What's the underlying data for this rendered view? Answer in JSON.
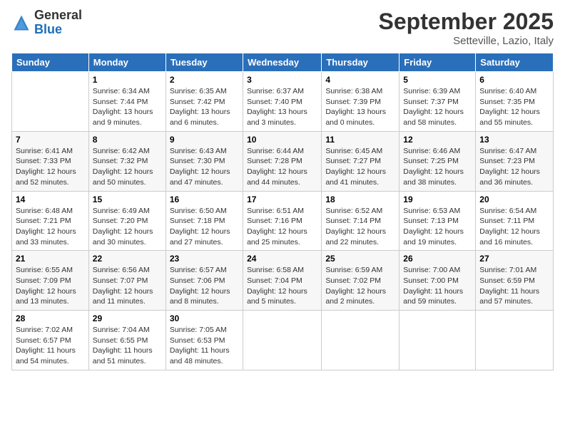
{
  "header": {
    "logo_general": "General",
    "logo_blue": "Blue",
    "month": "September 2025",
    "location": "Setteville, Lazio, Italy"
  },
  "days_of_week": [
    "Sunday",
    "Monday",
    "Tuesday",
    "Wednesday",
    "Thursday",
    "Friday",
    "Saturday"
  ],
  "weeks": [
    [
      {
        "num": "",
        "sunrise": "",
        "sunset": "",
        "daylight": ""
      },
      {
        "num": "1",
        "sunrise": "Sunrise: 6:34 AM",
        "sunset": "Sunset: 7:44 PM",
        "daylight": "Daylight: 13 hours and 9 minutes."
      },
      {
        "num": "2",
        "sunrise": "Sunrise: 6:35 AM",
        "sunset": "Sunset: 7:42 PM",
        "daylight": "Daylight: 13 hours and 6 minutes."
      },
      {
        "num": "3",
        "sunrise": "Sunrise: 6:37 AM",
        "sunset": "Sunset: 7:40 PM",
        "daylight": "Daylight: 13 hours and 3 minutes."
      },
      {
        "num": "4",
        "sunrise": "Sunrise: 6:38 AM",
        "sunset": "Sunset: 7:39 PM",
        "daylight": "Daylight: 13 hours and 0 minutes."
      },
      {
        "num": "5",
        "sunrise": "Sunrise: 6:39 AM",
        "sunset": "Sunset: 7:37 PM",
        "daylight": "Daylight: 12 hours and 58 minutes."
      },
      {
        "num": "6",
        "sunrise": "Sunrise: 6:40 AM",
        "sunset": "Sunset: 7:35 PM",
        "daylight": "Daylight: 12 hours and 55 minutes."
      }
    ],
    [
      {
        "num": "7",
        "sunrise": "Sunrise: 6:41 AM",
        "sunset": "Sunset: 7:33 PM",
        "daylight": "Daylight: 12 hours and 52 minutes."
      },
      {
        "num": "8",
        "sunrise": "Sunrise: 6:42 AM",
        "sunset": "Sunset: 7:32 PM",
        "daylight": "Daylight: 12 hours and 50 minutes."
      },
      {
        "num": "9",
        "sunrise": "Sunrise: 6:43 AM",
        "sunset": "Sunset: 7:30 PM",
        "daylight": "Daylight: 12 hours and 47 minutes."
      },
      {
        "num": "10",
        "sunrise": "Sunrise: 6:44 AM",
        "sunset": "Sunset: 7:28 PM",
        "daylight": "Daylight: 12 hours and 44 minutes."
      },
      {
        "num": "11",
        "sunrise": "Sunrise: 6:45 AM",
        "sunset": "Sunset: 7:27 PM",
        "daylight": "Daylight: 12 hours and 41 minutes."
      },
      {
        "num": "12",
        "sunrise": "Sunrise: 6:46 AM",
        "sunset": "Sunset: 7:25 PM",
        "daylight": "Daylight: 12 hours and 38 minutes."
      },
      {
        "num": "13",
        "sunrise": "Sunrise: 6:47 AM",
        "sunset": "Sunset: 7:23 PM",
        "daylight": "Daylight: 12 hours and 36 minutes."
      }
    ],
    [
      {
        "num": "14",
        "sunrise": "Sunrise: 6:48 AM",
        "sunset": "Sunset: 7:21 PM",
        "daylight": "Daylight: 12 hours and 33 minutes."
      },
      {
        "num": "15",
        "sunrise": "Sunrise: 6:49 AM",
        "sunset": "Sunset: 7:20 PM",
        "daylight": "Daylight: 12 hours and 30 minutes."
      },
      {
        "num": "16",
        "sunrise": "Sunrise: 6:50 AM",
        "sunset": "Sunset: 7:18 PM",
        "daylight": "Daylight: 12 hours and 27 minutes."
      },
      {
        "num": "17",
        "sunrise": "Sunrise: 6:51 AM",
        "sunset": "Sunset: 7:16 PM",
        "daylight": "Daylight: 12 hours and 25 minutes."
      },
      {
        "num": "18",
        "sunrise": "Sunrise: 6:52 AM",
        "sunset": "Sunset: 7:14 PM",
        "daylight": "Daylight: 12 hours and 22 minutes."
      },
      {
        "num": "19",
        "sunrise": "Sunrise: 6:53 AM",
        "sunset": "Sunset: 7:13 PM",
        "daylight": "Daylight: 12 hours and 19 minutes."
      },
      {
        "num": "20",
        "sunrise": "Sunrise: 6:54 AM",
        "sunset": "Sunset: 7:11 PM",
        "daylight": "Daylight: 12 hours and 16 minutes."
      }
    ],
    [
      {
        "num": "21",
        "sunrise": "Sunrise: 6:55 AM",
        "sunset": "Sunset: 7:09 PM",
        "daylight": "Daylight: 12 hours and 13 minutes."
      },
      {
        "num": "22",
        "sunrise": "Sunrise: 6:56 AM",
        "sunset": "Sunset: 7:07 PM",
        "daylight": "Daylight: 12 hours and 11 minutes."
      },
      {
        "num": "23",
        "sunrise": "Sunrise: 6:57 AM",
        "sunset": "Sunset: 7:06 PM",
        "daylight": "Daylight: 12 hours and 8 minutes."
      },
      {
        "num": "24",
        "sunrise": "Sunrise: 6:58 AM",
        "sunset": "Sunset: 7:04 PM",
        "daylight": "Daylight: 12 hours and 5 minutes."
      },
      {
        "num": "25",
        "sunrise": "Sunrise: 6:59 AM",
        "sunset": "Sunset: 7:02 PM",
        "daylight": "Daylight: 12 hours and 2 minutes."
      },
      {
        "num": "26",
        "sunrise": "Sunrise: 7:00 AM",
        "sunset": "Sunset: 7:00 PM",
        "daylight": "Daylight: 11 hours and 59 minutes."
      },
      {
        "num": "27",
        "sunrise": "Sunrise: 7:01 AM",
        "sunset": "Sunset: 6:59 PM",
        "daylight": "Daylight: 11 hours and 57 minutes."
      }
    ],
    [
      {
        "num": "28",
        "sunrise": "Sunrise: 7:02 AM",
        "sunset": "Sunset: 6:57 PM",
        "daylight": "Daylight: 11 hours and 54 minutes."
      },
      {
        "num": "29",
        "sunrise": "Sunrise: 7:04 AM",
        "sunset": "Sunset: 6:55 PM",
        "daylight": "Daylight: 11 hours and 51 minutes."
      },
      {
        "num": "30",
        "sunrise": "Sunrise: 7:05 AM",
        "sunset": "Sunset: 6:53 PM",
        "daylight": "Daylight: 11 hours and 48 minutes."
      },
      {
        "num": "",
        "sunrise": "",
        "sunset": "",
        "daylight": ""
      },
      {
        "num": "",
        "sunrise": "",
        "sunset": "",
        "daylight": ""
      },
      {
        "num": "",
        "sunrise": "",
        "sunset": "",
        "daylight": ""
      },
      {
        "num": "",
        "sunrise": "",
        "sunset": "",
        "daylight": ""
      }
    ]
  ]
}
